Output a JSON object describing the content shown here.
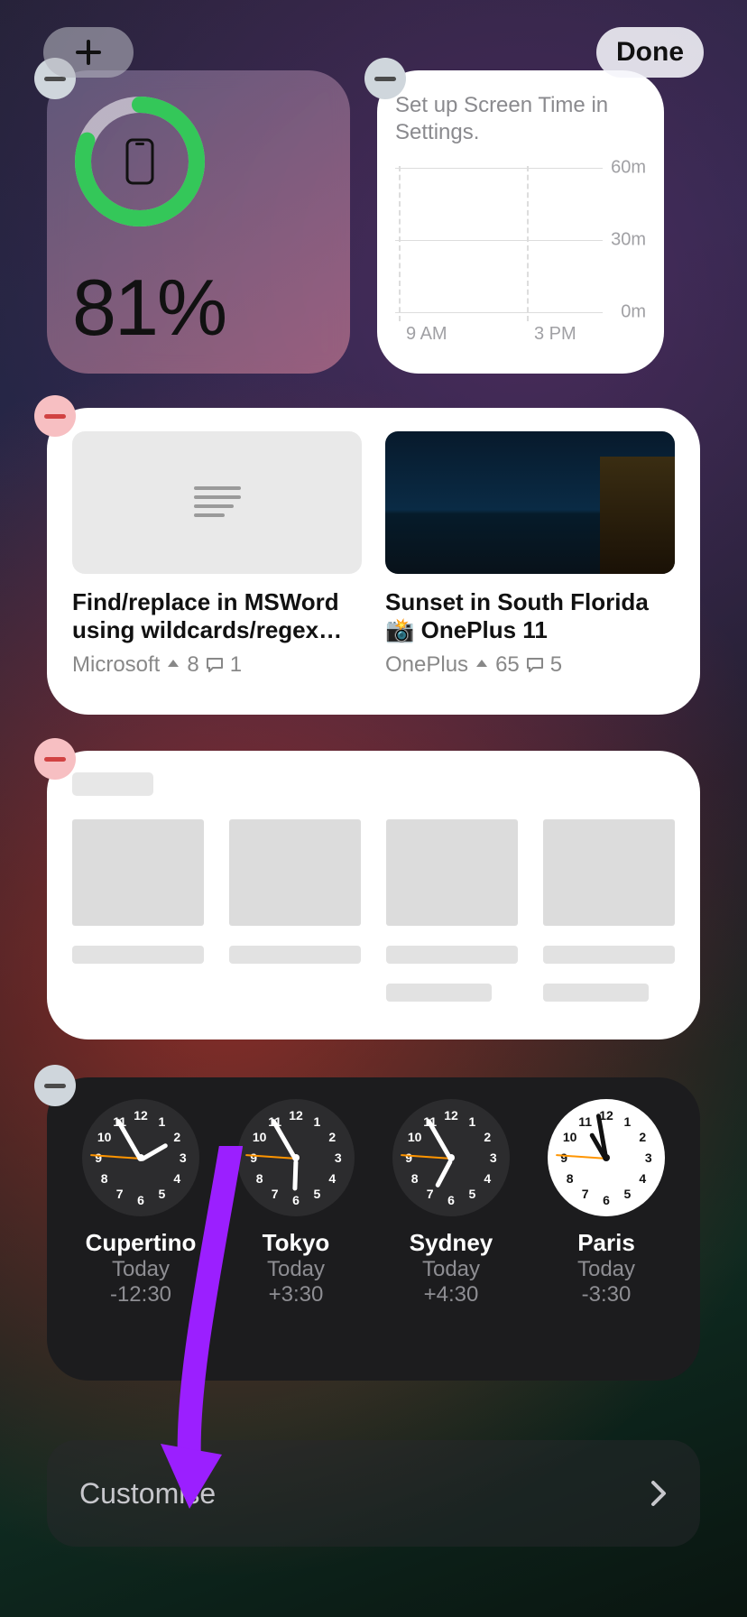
{
  "toolbar": {
    "done_label": "Done"
  },
  "battery": {
    "percent_label": "81%",
    "percent_value": 81
  },
  "screen_time": {
    "message": "Set up Screen Time in Settings.",
    "x_labels": [
      "9 AM",
      "3 PM"
    ],
    "y_labels": [
      "60m",
      "30m",
      "0m"
    ]
  },
  "posts": [
    {
      "title": "Find/replace in MSWord using wildcards/regex…",
      "community": "Microsoft",
      "upvotes": "8",
      "comments": "1",
      "thumb_type": "article"
    },
    {
      "title": "Sunset in South Florida 📸 OnePlus 11",
      "community": "OnePlus",
      "upvotes": "65",
      "comments": "5",
      "thumb_type": "photo"
    }
  ],
  "world_clock": [
    {
      "city": "Cupertino",
      "day": "Today",
      "offset": "-12:30",
      "hour_angle": 60,
      "min_angle": -30,
      "sec_angle": -86,
      "face": "dark"
    },
    {
      "city": "Tokyo",
      "day": "Today",
      "offset": "+3:30",
      "hour_angle": 182,
      "min_angle": -30,
      "sec_angle": -86,
      "face": "dark"
    },
    {
      "city": "Sydney",
      "day": "Today",
      "offset": "+4:30",
      "hour_angle": 208,
      "min_angle": -30,
      "sec_angle": -86,
      "face": "dark"
    },
    {
      "city": "Paris",
      "day": "Today",
      "offset": "-3:30",
      "hour_angle": -30,
      "min_angle": -10,
      "sec_angle": -86,
      "face": "white"
    }
  ],
  "customise": {
    "label": "Customise"
  }
}
